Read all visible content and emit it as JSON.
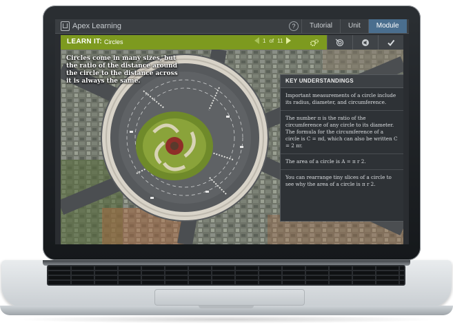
{
  "app": {
    "logo_text": "Apex Learning",
    "help_label": "?",
    "tabs": [
      "Tutorial",
      "Unit",
      "Module"
    ],
    "active_tab": "Module"
  },
  "lesson": {
    "section_label": "LEARN IT:",
    "title": "Circles",
    "page_current": "1",
    "page_of": "of",
    "page_total": "11"
  },
  "toolbar": {
    "tools": [
      "gears-icon",
      "target-icon",
      "audio-icon",
      "checkmark-icon"
    ]
  },
  "content": {
    "caption": "Circles come in many sizes, but the ratio of the distance around the circle to the distance across it is always the same."
  },
  "panel": {
    "heading": "KEY UNDERSTANDINGS",
    "items": [
      "Important measurements of a circle include its radius, diameter, and circumference.",
      "The number π is the ratio of the circumference of any circle to its diameter. The formula for the circumference of a circle is C = πd, which can also be written C = 2 πr.",
      "The area of a circle is A = π r 2.",
      "You can rearrange tiny slices of a circle to see why the area of a circle is π r 2."
    ]
  },
  "colors": {
    "accent_green": "#7d9a1f",
    "active_tab_blue": "#4a6e8e"
  }
}
